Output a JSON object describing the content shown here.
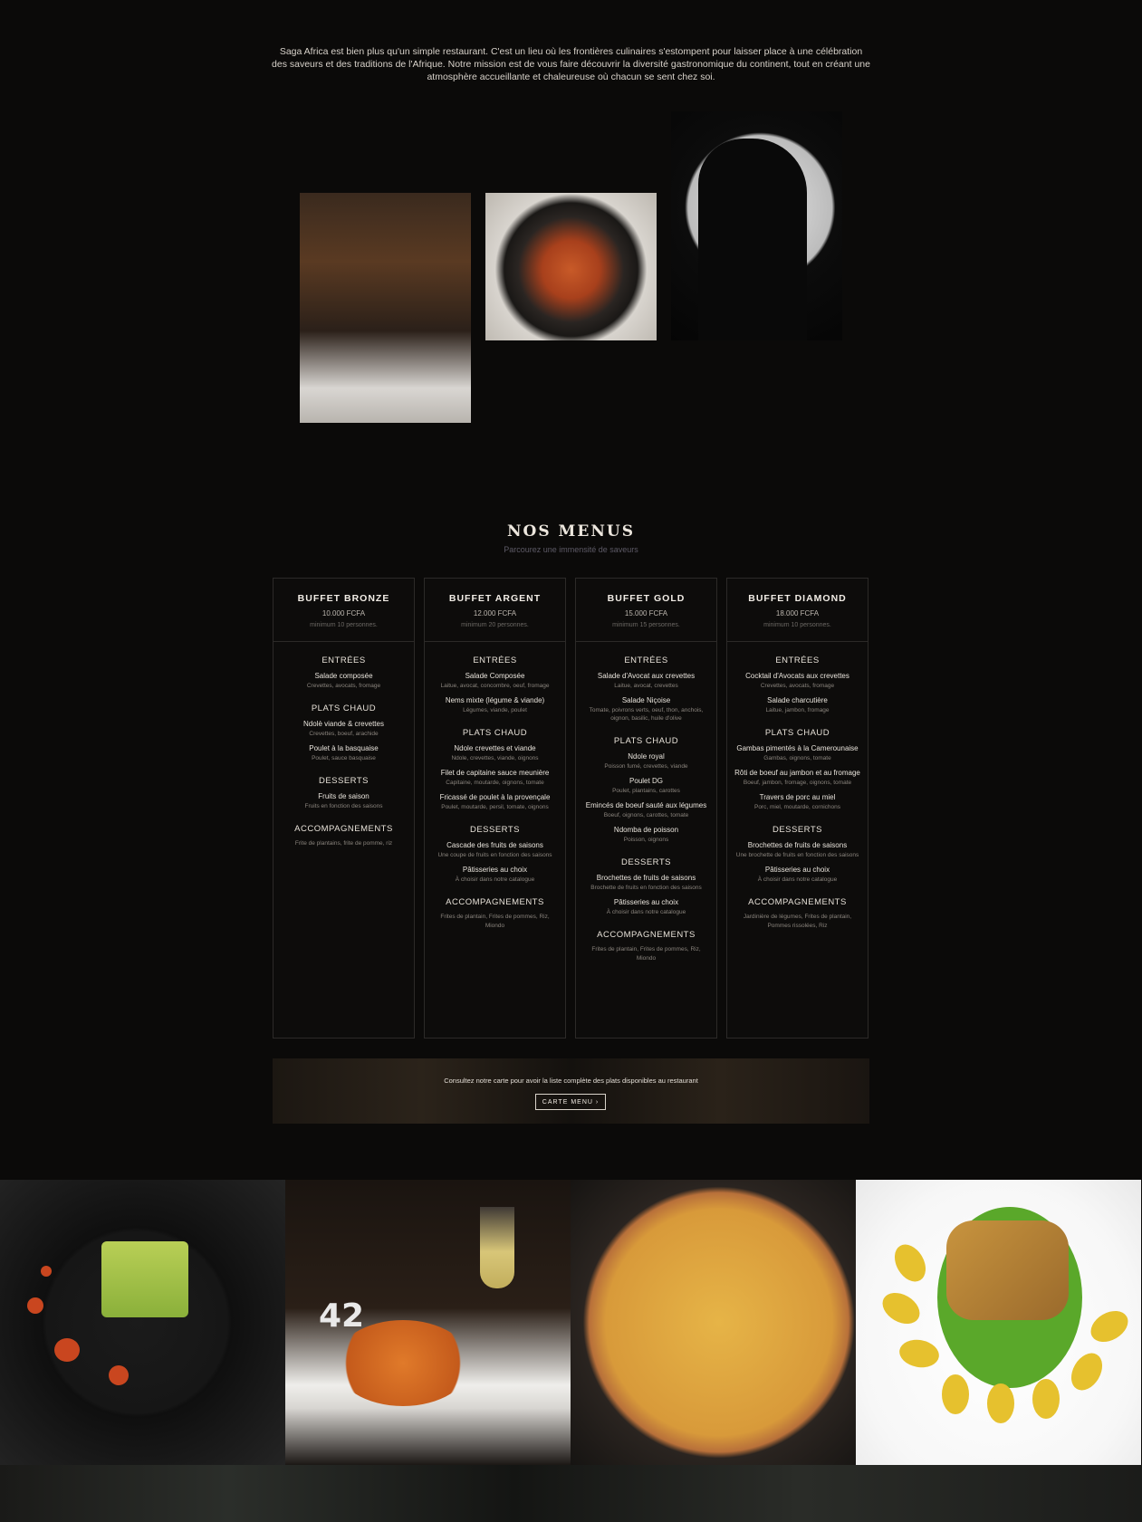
{
  "intro": {
    "text": "Saga Africa est bien plus qu'un simple restaurant. C'est un lieu où les frontières culinaires s'estompent pour laisser place à une célébration des saveurs et des traditions de l'Afrique. Notre mission est de vous faire découvrir la diversité gastronomique du continent, tout en créant une atmosphère accueillante et chaleureuse où chacun se sent chez soi."
  },
  "menus": {
    "title": "NOS MENUS",
    "subtitle": "Parcourez une immensité de saveurs",
    "cards": [
      {
        "title": "BUFFET BRONZE",
        "price": "10.000 FCFA",
        "minimum": "minimum 10 personnes.",
        "sections": [
          {
            "title": "ENTRÉES",
            "items": [
              {
                "name": "Salade composée",
                "desc": "Crevettes, avocats, fromage"
              }
            ]
          },
          {
            "title": "PLATS CHAUD",
            "items": [
              {
                "name": "Ndolè viande & crevettes",
                "desc": "Crevettes, boeuf, arachide"
              },
              {
                "name": "Poulet à la basquaise",
                "desc": "Poulet, sauce basquaise"
              }
            ]
          },
          {
            "title": "DESSERTS",
            "items": [
              {
                "name": "Fruits de saison",
                "desc": "Fruits en fonction des saisons"
              }
            ]
          }
        ],
        "accompagnements_title": "ACCOMPAGNEMENTS",
        "accompagnements": "Frite de plantains, frite de pomme, riz"
      },
      {
        "title": "BUFFET ARGENT",
        "price": "12.000 FCFA",
        "minimum": "minimum 20 personnes.",
        "sections": [
          {
            "title": "ENTRÉES",
            "items": [
              {
                "name": "Salade Composée",
                "desc": "Laitue, avocat, concombre, oeuf, fromage"
              },
              {
                "name": "Nems mixte (légume & viande)",
                "desc": "Légumes, viande, poulet"
              }
            ]
          },
          {
            "title": "PLATS CHAUD",
            "items": [
              {
                "name": "Ndole crevettes et viande",
                "desc": "Ndole, crevettes, viande, oignons"
              },
              {
                "name": "Filet de capitaine sauce meunière",
                "desc": "Capitaine, moutarde, oignons, tomate"
              },
              {
                "name": "Fricassé de poulet à la provençale",
                "desc": "Poulet, moutarde, persil, tomate, oignons"
              }
            ]
          },
          {
            "title": "DESSERTS",
            "items": [
              {
                "name": "Cascade des fruits de saisons",
                "desc": "Une coupe de fruits en fonction des saisons"
              },
              {
                "name": "Pâtisseries au choix",
                "desc": "À choisir dans notre catalogue"
              }
            ]
          }
        ],
        "accompagnements_title": "ACCOMPAGNEMENTS",
        "accompagnements": "Frites de plantain, Frites de pommes, Riz, Miondo"
      },
      {
        "title": "BUFFET GOLD",
        "price": "15.000 FCFA",
        "minimum": "minimum 15 personnes.",
        "sections": [
          {
            "title": "ENTRÉES",
            "items": [
              {
                "name": "Salade d'Avocat aux crevettes",
                "desc": "Laitue, avocat, crevettes"
              },
              {
                "name": "Salade Niçoise",
                "desc": "Tomate, poivrons verts, oeuf, thon, anchois, oignon, basilic, huile d'olive"
              }
            ]
          },
          {
            "title": "PLATS CHAUD",
            "items": [
              {
                "name": "Ndole royal",
                "desc": "Poisson fumé, crevettes, viande"
              },
              {
                "name": "Poulet DG",
                "desc": "Poulet, plantains, carottes"
              },
              {
                "name": "Emincés de boeuf sauté aux légumes",
                "desc": "Boeuf, oignons, carottes, tomate"
              },
              {
                "name": "Ndomba de poisson",
                "desc": "Poisson, oignons"
              }
            ]
          },
          {
            "title": "DESSERTS",
            "items": [
              {
                "name": "Brochettes de fruits de saisons",
                "desc": "Brochette de fruits en fonction des saisons"
              },
              {
                "name": "Pâtisseries au choix",
                "desc": "À choisir dans notre catalogue"
              }
            ]
          }
        ],
        "accompagnements_title": "ACCOMPAGNEMENTS",
        "accompagnements": "Frites de plantain, Frites de pommes, Riz, Miondo"
      },
      {
        "title": "BUFFET DIAMOND",
        "price": "18.000 FCFA",
        "minimum": "minimum 10 personnes.",
        "sections": [
          {
            "title": "ENTRÉES",
            "items": [
              {
                "name": "Cocktail d'Avocats aux crevettes",
                "desc": "Crevettes, avocats, fromage"
              },
              {
                "name": "Salade charcutière",
                "desc": "Laitue, jambon, fromage"
              }
            ]
          },
          {
            "title": "PLATS CHAUD",
            "items": [
              {
                "name": "Gambas pimentés à la Camerounaise",
                "desc": "Gambas, oignons, tomate"
              },
              {
                "name": "Rôti de boeuf au jambon et au fromage",
                "desc": "Boeuf, jambon, fromage, oignons, tomate"
              },
              {
                "name": "Travers de porc au miel",
                "desc": "Porc, miel, moutarde, cornichons"
              }
            ]
          },
          {
            "title": "DESSERTS",
            "items": [
              {
                "name": "Brochettes de fruits de saisons",
                "desc": "Une brochette de fruits en fonction des saisons"
              },
              {
                "name": "Pâtisseries au choix",
                "desc": "À choisir dans notre catalogue"
              }
            ]
          }
        ],
        "accompagnements_title": "ACCOMPAGNEMENTS",
        "accompagnements": "Jardinière de légumes, Frites de plantain, Pommes rissolées, Riz"
      }
    ]
  },
  "banner": {
    "text": "Consultez notre carte pour avoir la liste complète des plats disponibles au restaurant",
    "button": "CARTE MENU ›"
  },
  "gallery": {
    "plate_number": "42"
  },
  "colors": {
    "background": "#0b0a09",
    "card_border": "#2c2a28",
    "subtitle": "#5d5a66"
  }
}
